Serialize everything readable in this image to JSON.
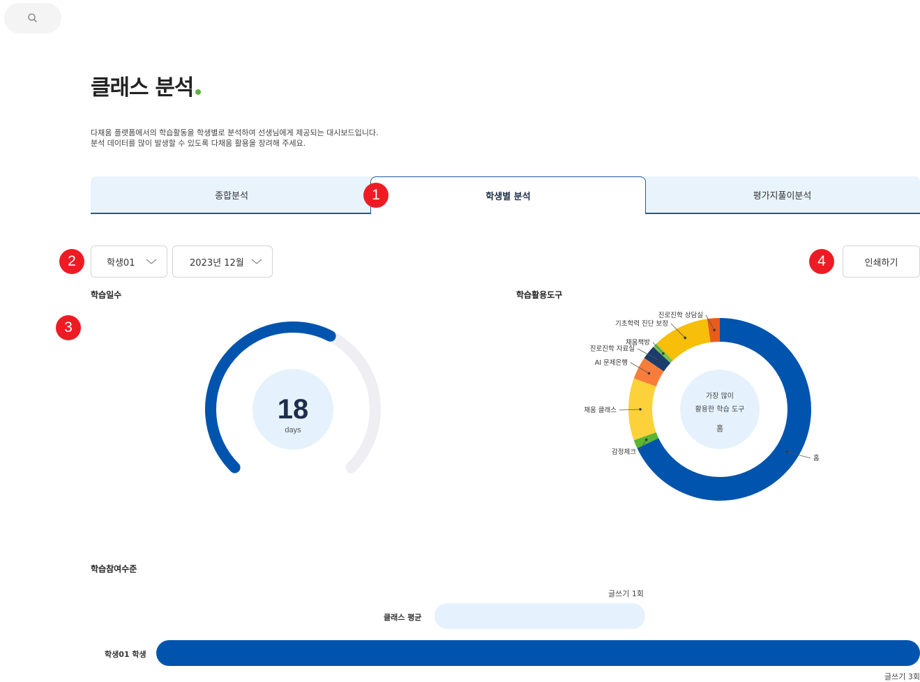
{
  "search": {
    "icon": "search-icon"
  },
  "page": {
    "title": "클래스 분석",
    "description_line1": "다채움 플랫폼에서의 학습활동을 학생별로 분석하여 선생님에게 제공되는 대시보드입니다.",
    "description_line2": "분석 데이터를 많이 발생할 수 있도록 다채움 활용을 장려해 주세요."
  },
  "tabs": [
    {
      "label": "종합분석",
      "active": false
    },
    {
      "label": "학생별 분석",
      "active": true
    },
    {
      "label": "평가지풀이분석",
      "active": false
    }
  ],
  "markers": [
    "1",
    "2",
    "3",
    "4"
  ],
  "filters": {
    "student": "학생01",
    "month": "2023년 12월"
  },
  "print_label": "인쇄하기",
  "learning_days": {
    "title": "학습일수",
    "value": "18",
    "unit": "days",
    "fraction": 0.6
  },
  "tool_usage": {
    "title": "학습활용도구",
    "center_line1": "가장 많이",
    "center_line2": "활용한 학습 도구",
    "center_value": "홈"
  },
  "chart_data": {
    "type": "pie",
    "donut": true,
    "title": "학습활용도구",
    "categories": [
      "홈",
      "감정체크",
      "채움 클래스",
      "AI 문제은행",
      "진로진학 자료실",
      "채움책방",
      "기초학력 진단 보정",
      "진로진학 상담실"
    ],
    "values": [
      68,
      1.5,
      11,
      4,
      2.5,
      0.8,
      10,
      2.2
    ],
    "colors": [
      "#0054ad",
      "#5ab532",
      "#fdd13a",
      "#f97d3a",
      "#1a3d6e",
      "#7ac24a",
      "#f7be0a",
      "#ea5a1b"
    ]
  },
  "participation": {
    "title": "학습참여수준",
    "class_avg_label": "클래스 평균",
    "class_avg_caption": "글쓰기 1회",
    "class_avg_value": 1,
    "student_label": "학생01 학생",
    "student_caption": "글쓰기 3회",
    "student_value": 3
  },
  "colors": {
    "primary": "#0054ad",
    "light_blue": "#e5f2fd",
    "accent_green": "#5bb53a",
    "marker_red": "#ed1c24"
  }
}
